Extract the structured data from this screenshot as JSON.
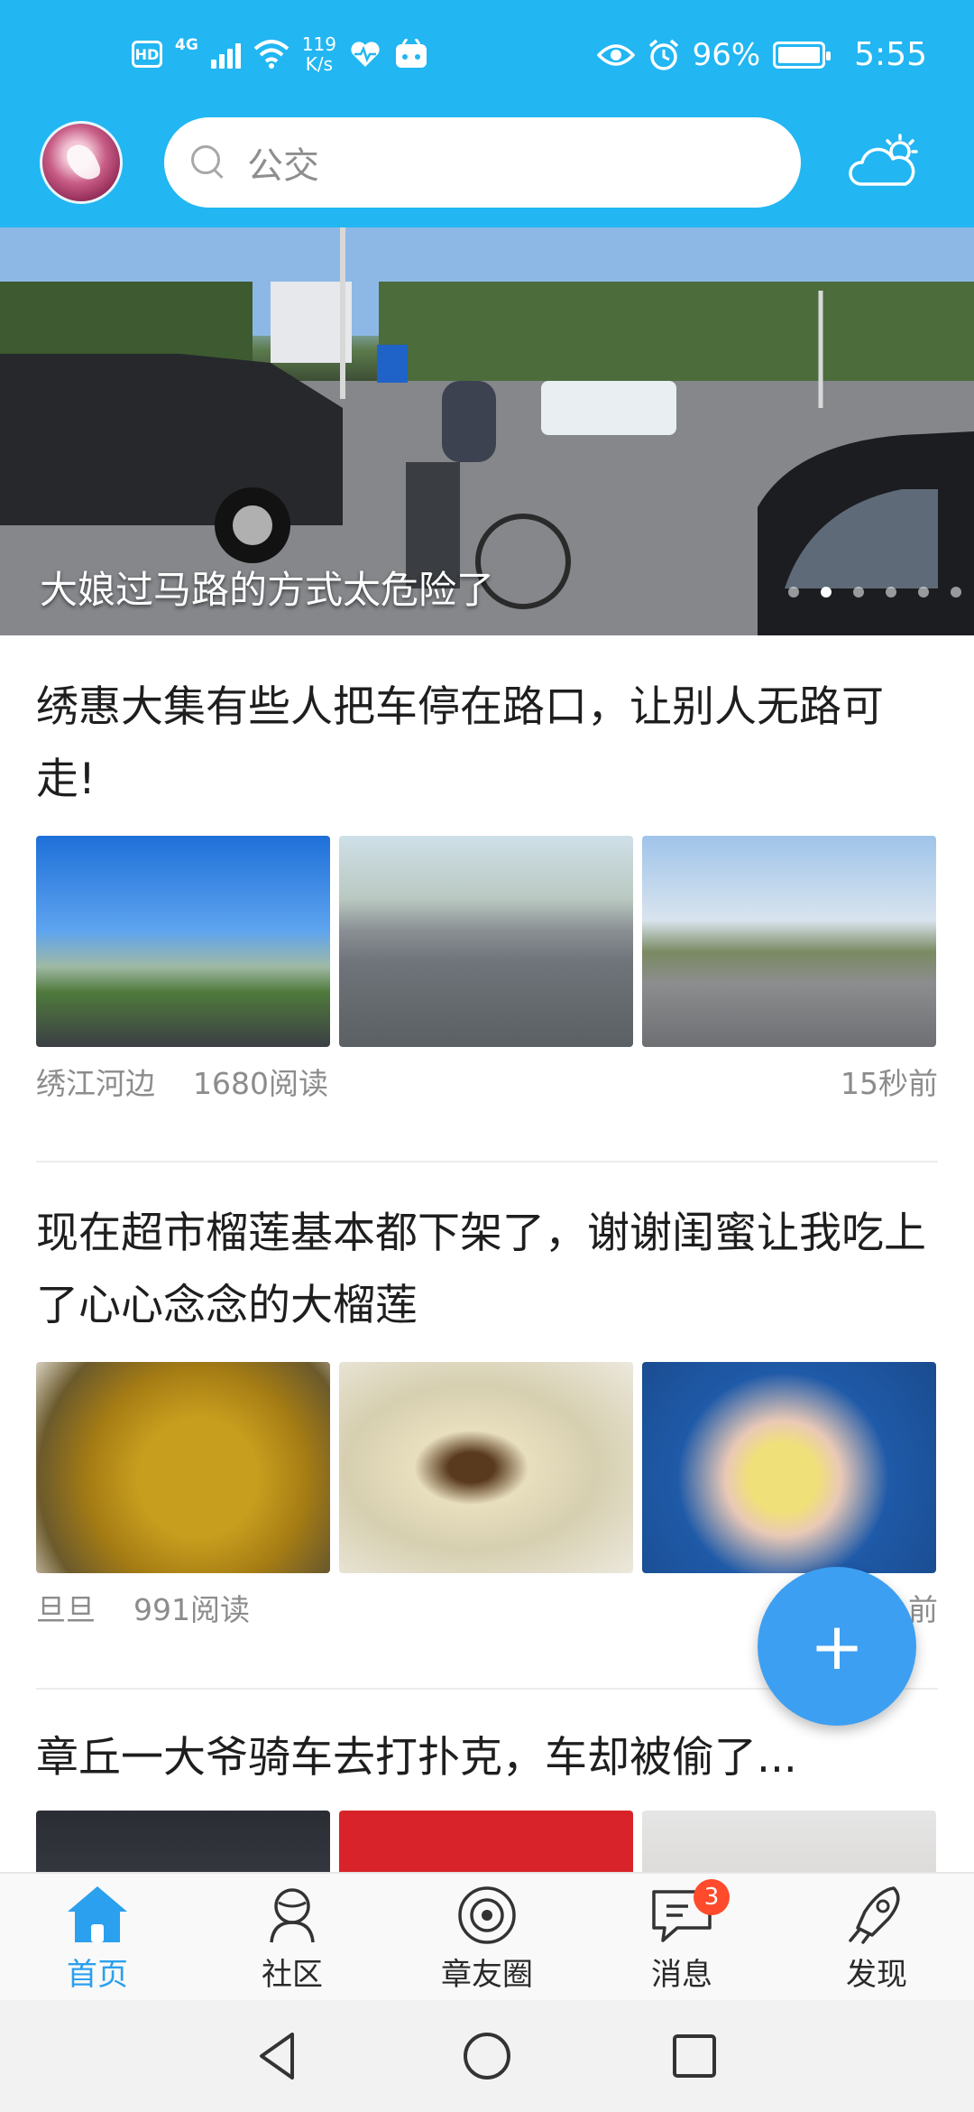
{
  "status_bar": {
    "hd": "HD",
    "network": "4G",
    "net_speed_value": "119",
    "net_speed_unit": "K/s",
    "battery_percent": "96%",
    "time": "5:55"
  },
  "header": {
    "search_placeholder": "公交"
  },
  "banner": {
    "caption": "大娘过马路的方式太危险了",
    "slide_count": 6,
    "active_slide": 1
  },
  "posts": [
    {
      "title": "绣惠大集有些人把车停在路口，让别人无路可走!",
      "author": "绣江河边",
      "reads": "1680阅读",
      "time": "15秒前"
    },
    {
      "title": "现在超市榴莲基本都下架了，谢谢闺蜜让我吃上了心心念念的大榴莲",
      "author": "旦旦",
      "reads": "991阅读",
      "time": "前"
    },
    {
      "title": "章丘一大爷骑车去打扑克，车却被偷了..."
    }
  ],
  "tabs": [
    {
      "label": "首页",
      "icon": "home-icon"
    },
    {
      "label": "社区",
      "icon": "community-icon"
    },
    {
      "label": "章友圈",
      "icon": "friends-circle-icon"
    },
    {
      "label": "消息",
      "icon": "message-icon",
      "badge": "3"
    },
    {
      "label": "发现",
      "icon": "discover-icon"
    }
  ],
  "colors": {
    "brand": "#22b6f2",
    "tab_active": "#2ba0ee",
    "fab": "#3d9ff2",
    "badge": "#ff4a2b"
  }
}
